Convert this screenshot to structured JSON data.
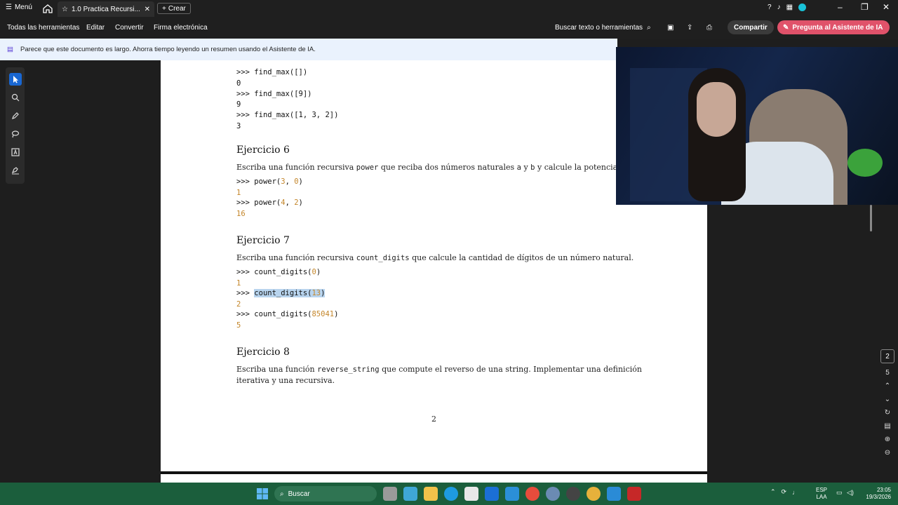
{
  "titlebar": {
    "menu_label": "Menú",
    "tab_title": "1.0 Practica Recursi...",
    "new_tab_label": "Crear"
  },
  "toolbar": {
    "items": [
      "Todas las herramientas",
      "Editar",
      "Convertir",
      "Firma electrónica"
    ],
    "search_label": "Buscar texto o herramientas",
    "share_label": "Compartir",
    "ai_label": "Pregunta al Asistente de IA"
  },
  "infobar": {
    "message": "Parece que este documento es largo. Ahorra tiempo leyendo un resumen usando el Asistente de IA."
  },
  "document": {
    "block1": [
      {
        "prompt": ">>> ",
        "call": "find_max([])",
        "result": "0"
      },
      {
        "prompt": ">>> ",
        "call": "find_max([9])",
        "result": "9"
      },
      {
        "prompt": ">>> ",
        "call": "find_max([1, 3, 2])",
        "result": "3"
      }
    ],
    "ex6": {
      "title": "Ejercicio 6",
      "text_a": "Escriba una función recursiva ",
      "code": "power",
      "text_b": " que reciba dos números naturales ",
      "var_a": "a",
      "text_c": " y ",
      "var_b": "b",
      "text_d": " y calcule la potencia",
      "examples": [
        {
          "prompt": ">>> ",
          "fn": "power(",
          "arg1": "3",
          "sep": ", ",
          "arg2": "0",
          "close": ")",
          "result": "1"
        },
        {
          "prompt": ">>> ",
          "fn": "power(",
          "arg1": "4",
          "sep": ", ",
          "arg2": "2",
          "close": ")",
          "result": "16"
        }
      ]
    },
    "ex7": {
      "title": "Ejercicio 7",
      "text_a": "Escriba una función recursiva ",
      "code": "count_digits",
      "text_b": " que calcule la cantidad de dígitos de un número natural.",
      "examples": [
        {
          "prompt": ">>> ",
          "fn": "count_digits(",
          "arg": "0",
          "close": ")",
          "result": "1"
        },
        {
          "prompt": ">>> ",
          "fn": "count_digits(",
          "arg": "13",
          "close": ")",
          "result": "2"
        },
        {
          "prompt": ">>> ",
          "fn": "count_digits(",
          "arg": "85041",
          "close": ")",
          "result": "5"
        }
      ]
    },
    "ex8": {
      "title": "Ejercicio 8",
      "text_a": "Escriba una función ",
      "code": "reverse_string",
      "text_b": " que compute el reverso de una string. Implementar una definición",
      "line2": "iterativa y una recursiva."
    },
    "page_number": "2"
  },
  "right_nav": {
    "current_page": "2",
    "total_pages": "5"
  },
  "taskbar": {
    "search_label": "Buscar",
    "lang_top": "ESP",
    "lang_bottom": "LAA",
    "time": "23:05",
    "date": "19/3/2026"
  },
  "colors": {
    "ai_button": "#e0526a",
    "taskbar": "#1b5e3c",
    "highlight": "#b8d4ee",
    "number_literal": "#c4862a"
  }
}
